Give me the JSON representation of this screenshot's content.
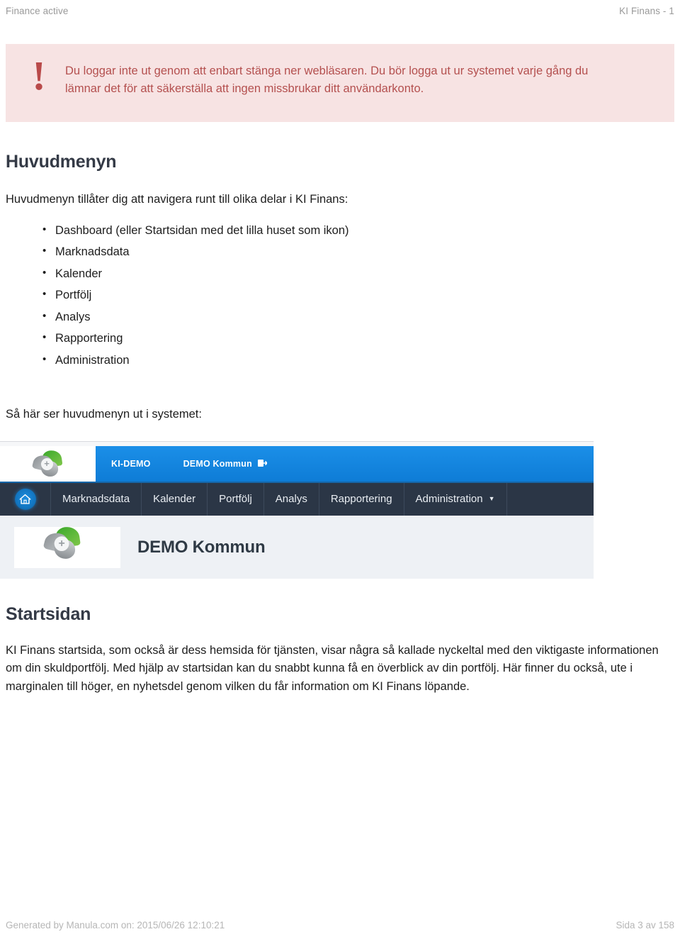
{
  "header": {
    "left": "Finance active",
    "right": "KI Finans - 1"
  },
  "callout": {
    "icon": "!",
    "text": "Du loggar inte ut genom att enbart stänga ner webläsaren. Du bör logga ut ur systemet varje gång du lämnar det för att säkerställa att ingen missbrukar ditt användarkonto.",
    "bg_color": "#f7e3e3",
    "text_color": "#b4504f"
  },
  "huvudmenyn": {
    "heading": "Huvudmenyn",
    "intro": "Huvudmenyn tillåter dig att navigera runt till olika delar i KI Finans:",
    "items": [
      "Dashboard (eller Startsidan med det lilla huset som ikon)",
      "Marknadsdata",
      "Kalender",
      "Portfölj",
      "Analys",
      "Rapportering",
      "Administration"
    ],
    "caption": "Så här ser huvudmenyn ut i systemet:"
  },
  "app_screenshot": {
    "top_bar": {
      "brand": "KI-DEMO",
      "organisation": "DEMO Kommun",
      "logout_icon": "logout-icon",
      "logout_glyph": "❯",
      "bg_color": "#0e7cd6"
    },
    "nav": {
      "home_icon": "home-icon",
      "items": [
        {
          "label": "Marknadsdata",
          "caret": ""
        },
        {
          "label": "Kalender",
          "caret": ""
        },
        {
          "label": "Portfölj",
          "caret": ""
        },
        {
          "label": "Analys",
          "caret": ""
        },
        {
          "label": "Rapportering",
          "caret": ""
        },
        {
          "label": "Administration",
          "caret": "▼"
        }
      ],
      "bg_color": "#2b3646"
    },
    "content": {
      "org_title": "DEMO Kommun",
      "logo_icon": "ki-finans-logo-icon",
      "bg_color": "#eef1f5"
    }
  },
  "startsidan": {
    "heading": "Startsidan",
    "paragraph": "KI Finans startsida, som också är dess hemsida för tjänsten, visar några så kallade nyckeltal med den viktigaste informationen om din skuldportfölj. Med hjälp av startsidan kan du snabbt kunna få en överblick av din portfölj. Här finner du också, ute i marginalen till höger, en nyhetsdel genom vilken du får information om KI Finans löpande."
  },
  "footer": {
    "left": "Generated by Manula.com on: 2015/06/26 12:10:21",
    "right": "Sida 3 av 158"
  }
}
